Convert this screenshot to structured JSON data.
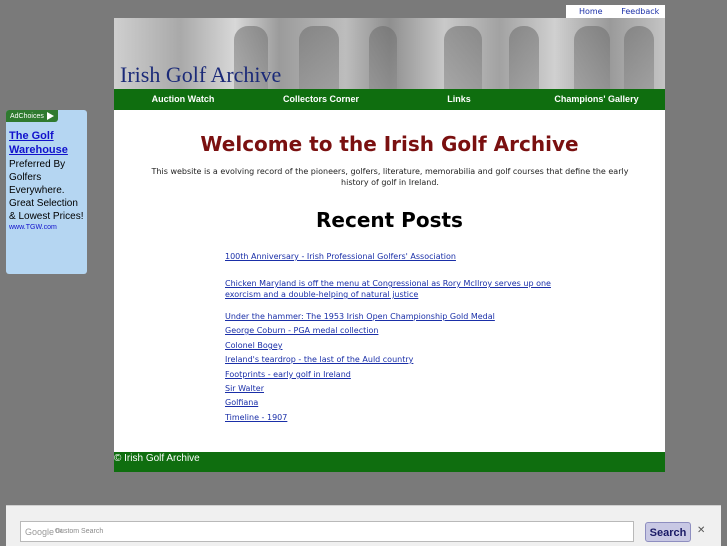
{
  "toplinks": {
    "home": "Home",
    "feedback": "Feedback"
  },
  "header": {
    "site_title": "Irish Golf Archive"
  },
  "nav": [
    {
      "label": "Auction Watch"
    },
    {
      "label": "Collectors Corner"
    },
    {
      "label": "Links"
    },
    {
      "label": "Champions' Gallery"
    }
  ],
  "ad": {
    "choices_label": "AdChoices",
    "choices_icon": "adchoices-triangle-icon",
    "title": "The Golf Warehouse",
    "text": "Preferred By Golfers Everywhere. Great Selection & Lowest Prices!",
    "url": "www.TGW.com"
  },
  "main": {
    "welcome": "Welcome to the Irish Golf Archive",
    "intro": "This website is a evolving record of the pioneers, golfers, literature, memorabilia and golf courses that define the early history of golf in Ireland.",
    "recent_heading": "Recent Posts",
    "posts": [
      "100th Anniversary - Irish Professional Golfers' Association",
      "Chicken Maryland is off the menu at Congressional as Rory McIlroy serves up one exorcism and a double-helping of natural justice",
      "Under the hammer: The 1953 Irish Open Championship Gold Medal",
      "George Coburn - PGA medal collection",
      "Colonel Bogey",
      "Ireland's teardrop - the last of the Auld country",
      "Footprints - early golf in Ireland",
      "Sir Walter",
      "Golfiana",
      "Timeline - 1907"
    ]
  },
  "footer": {
    "text": "© Irish Golf Archive"
  },
  "search": {
    "logo": "Google™",
    "placeholder": "Custom Search",
    "button_label": "Search",
    "close": "✕"
  },
  "colors": {
    "nav_green": "#0f6e0f",
    "welcome_red": "#7a1010",
    "link_blue": "#1a2fa8",
    "page_bg": "#7a7a7a"
  }
}
